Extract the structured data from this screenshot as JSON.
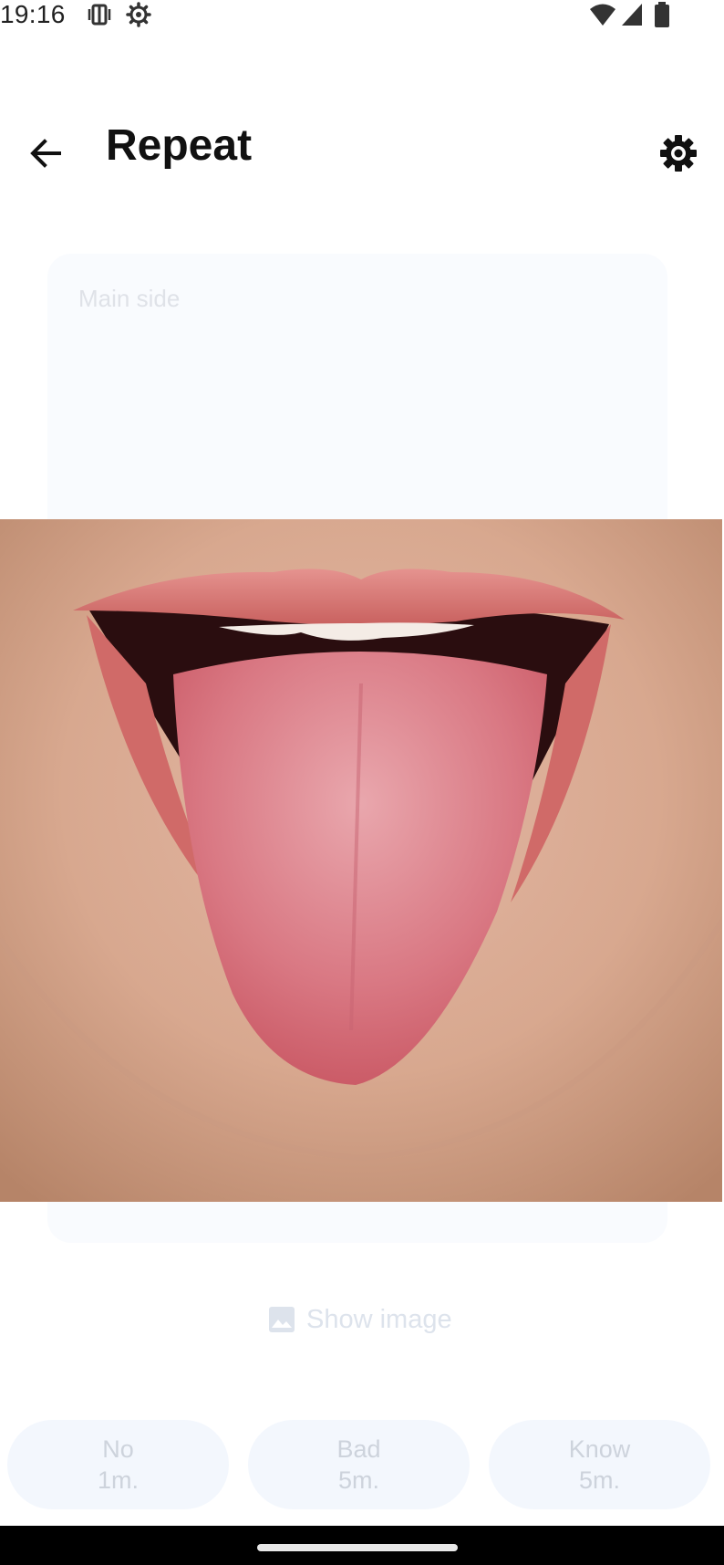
{
  "status_bar": {
    "time": "19:16",
    "icons": [
      "vibrate-icon",
      "system-settings-icon",
      "wifi-icon",
      "cellular-signal-icon",
      "battery-icon"
    ]
  },
  "app_bar": {
    "title": "Repeat",
    "back_icon": "arrow-left-icon",
    "settings_icon": "gear-icon"
  },
  "card": {
    "label": "Main side",
    "image": "photo of an open mouth with tongue extended"
  },
  "show_image": {
    "label": "Show image",
    "icon": "image-icon"
  },
  "answers": [
    {
      "title": "No",
      "interval": "1m."
    },
    {
      "title": "Bad",
      "interval": "5m."
    },
    {
      "title": "Know",
      "interval": "5m."
    }
  ],
  "colors": {
    "background": "#ffffff",
    "card": "#f9fbfe",
    "answer_button": "#f3f7fd",
    "muted_text": "#cdd3dc"
  }
}
